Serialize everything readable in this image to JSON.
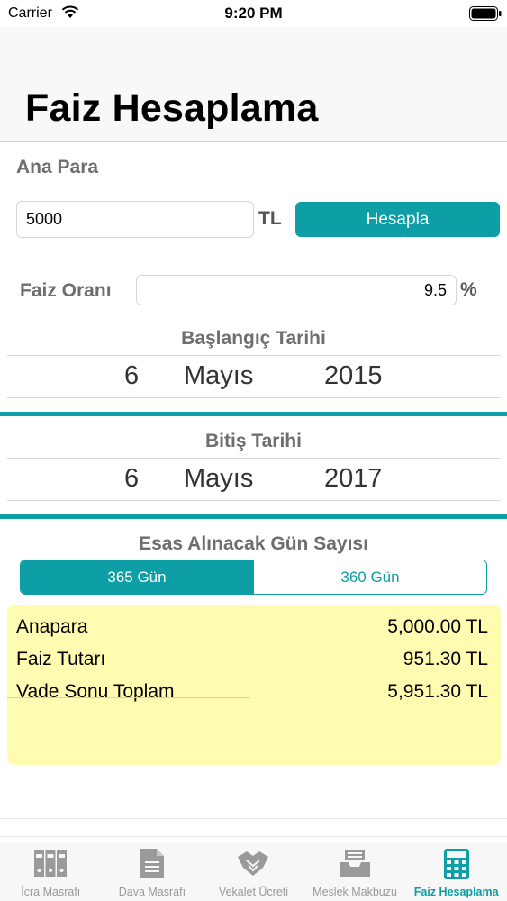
{
  "status_bar": {
    "carrier": "Carrier",
    "time": "9:20 PM"
  },
  "header": {
    "title": "Faiz Hesaplama"
  },
  "principal": {
    "label": "Ana Para",
    "value": "5000",
    "currency": "TL",
    "calculate_button": "Hesapla"
  },
  "rate": {
    "label": "Faiz Oranı",
    "value": "9.5",
    "unit": "%"
  },
  "start_date": {
    "heading": "Başlangıç Tarihi",
    "day": "6",
    "month": "Mayıs",
    "year": "2015"
  },
  "end_date": {
    "heading": "Bitiş Tarihi",
    "day": "6",
    "month": "Mayıs",
    "year": "2017"
  },
  "day_basis": {
    "heading": "Esas Alınacak Gün Sayısı",
    "options": [
      "365 Gün",
      "360 Gün"
    ],
    "selected": "365 Gün"
  },
  "results": [
    {
      "label": "Anapara",
      "value": "5,000.00 TL"
    },
    {
      "label": "Faiz Tutarı",
      "value": "951.30 TL"
    },
    {
      "label": "Vade Sonu Toplam",
      "value": "5,951.30 TL"
    }
  ],
  "tabs": [
    {
      "label": "İcra Masrafı",
      "icon": "binders-icon"
    },
    {
      "label": "Dava Masrafı",
      "icon": "document-icon"
    },
    {
      "label": "Vekalet Ücreti",
      "icon": "handshake-icon"
    },
    {
      "label": "Meslek Makbuzu",
      "icon": "inbox-tray-icon"
    },
    {
      "label": "Faiz Hesaplama",
      "icon": "calculator-icon",
      "active": true
    }
  ],
  "colors": {
    "accent": "#0e9ea5",
    "results_bg": "#fffbb0",
    "label_gray": "#6e6e6e"
  }
}
